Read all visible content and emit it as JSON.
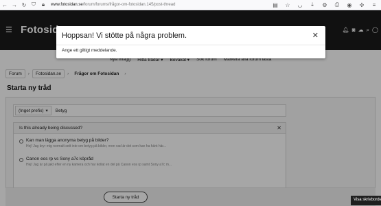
{
  "browser": {
    "url_domain": "www.fotosidan.se",
    "url_path": "/forum/forums/frågor-om-fotosidan.145/post-thread"
  },
  "site": {
    "logo": "Fotosidan"
  },
  "subnav": {
    "items": [
      "Nya inlägg",
      "Hitta trådar ▾",
      "Bevakat ▾",
      "Sök forum",
      "Markera alla forum lästa"
    ]
  },
  "breadcrumb": {
    "items": [
      "Forum",
      "Fotosidan.se",
      "Frågor om Fotosidan"
    ]
  },
  "page": {
    "title": "Starta ny tråd"
  },
  "form": {
    "prefix": "(Inget prefix)",
    "title_value": "Betyg",
    "discussed_heading": "Is this already being discussed?",
    "threads": [
      {
        "title": "Kan man lägga anonyma betyg på bilder?",
        "snippet": "Hej! Jag bryr mig normalt sett inte om betyg på bilder, men vad är det som kan ha hänt här..."
      },
      {
        "title": "Canon eos rp vs Sony a7c köpråd",
        "snippet": "Hej! Jag är på jakt efter en ny kamera och har kollat en del på Canon eos rp samt Sony a7c m..."
      }
    ],
    "submit_label": "Starta ny tråd"
  },
  "modal": {
    "title": "Hoppsan! Vi stötte på några problem.",
    "message": "Ange ett giltigt meddelande.",
    "close": "✕"
  },
  "tooltip": {
    "text": "Visa skrivbordet"
  }
}
